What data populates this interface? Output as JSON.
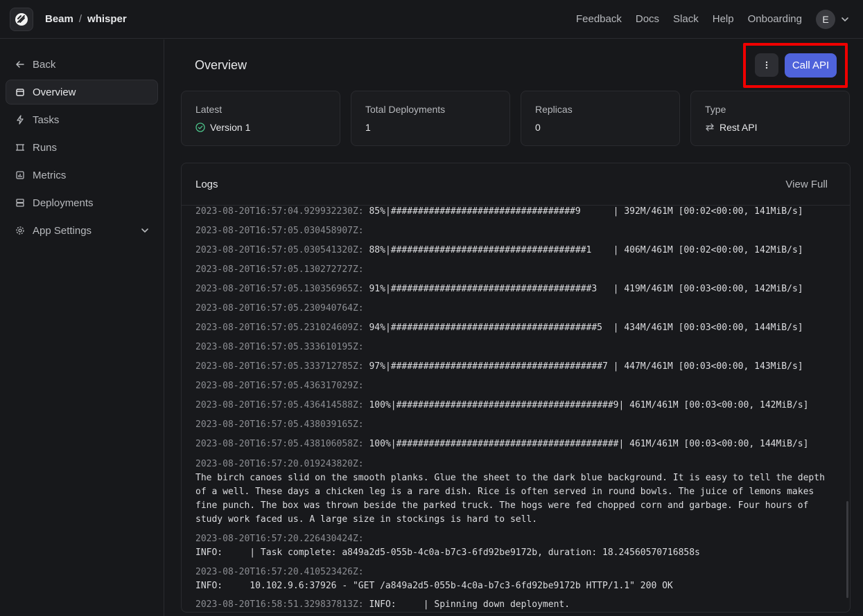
{
  "topbar": {
    "org": "Beam",
    "separator": "/",
    "app": "whisper",
    "nav": [
      "Feedback",
      "Docs",
      "Slack",
      "Help",
      "Onboarding"
    ],
    "avatar_initial": "E"
  },
  "sidebar": {
    "items": [
      {
        "label": "Back",
        "icon": "arrow-left-icon"
      },
      {
        "label": "Overview",
        "icon": "calendar-icon"
      },
      {
        "label": "Tasks",
        "icon": "bolt-icon"
      },
      {
        "label": "Runs",
        "icon": "runs-icon"
      },
      {
        "label": "Metrics",
        "icon": "chart-icon"
      },
      {
        "label": "Deployments",
        "icon": "server-icon"
      },
      {
        "label": "App Settings",
        "icon": "gear-icon"
      }
    ]
  },
  "main": {
    "title": "Overview",
    "call_api_label": "Call API",
    "cards": [
      {
        "label": "Latest",
        "value": "Version 1"
      },
      {
        "label": "Total Deployments",
        "value": "1"
      },
      {
        "label": "Replicas",
        "value": "0"
      },
      {
        "label": "Type",
        "value": "Rest API"
      }
    ]
  },
  "logs": {
    "title": "Logs",
    "view_full_label": "View Full",
    "lines": [
      {
        "ts": "2023-08-20T16:57:04.929932230Z:",
        "msg": " 85%|##################################9      | 392M/461M [00:02<00:00, 141MiB/s]"
      },
      {
        "ts": "2023-08-20T16:57:05.030458907Z:",
        "msg": ""
      },
      {
        "ts": "2023-08-20T16:57:05.030541320Z:",
        "msg": " 88%|####################################1    | 406M/461M [00:02<00:00, 142MiB/s]"
      },
      {
        "ts": "2023-08-20T16:57:05.130272727Z:",
        "msg": ""
      },
      {
        "ts": "2023-08-20T16:57:05.130356965Z:",
        "msg": " 91%|#####################################3   | 419M/461M [00:03<00:00, 142MiB/s]"
      },
      {
        "ts": "2023-08-20T16:57:05.230940764Z:",
        "msg": ""
      },
      {
        "ts": "2023-08-20T16:57:05.231024609Z:",
        "msg": " 94%|######################################5  | 434M/461M [00:03<00:00, 144MiB/s]"
      },
      {
        "ts": "2023-08-20T16:57:05.333610195Z:",
        "msg": ""
      },
      {
        "ts": "2023-08-20T16:57:05.333712785Z:",
        "msg": " 97%|#######################################7 | 447M/461M [00:03<00:00, 143MiB/s]"
      },
      {
        "ts": "2023-08-20T16:57:05.436317029Z:",
        "msg": ""
      },
      {
        "ts": "2023-08-20T16:57:05.436414588Z:",
        "msg": " 100%|########################################9| 461M/461M [00:03<00:00, 142MiB/s]"
      },
      {
        "ts": "2023-08-20T16:57:05.438039165Z:",
        "msg": ""
      },
      {
        "ts": "2023-08-20T16:57:05.438106058Z:",
        "msg": " 100%|#########################################| 461M/461M [00:03<00:00, 144MiB/s]"
      }
    ],
    "blocks": [
      {
        "ts": "2023-08-20T16:57:20.019243820Z:",
        "msg": "The birch canoes slid on the smooth planks. Glue the sheet to the dark blue background. It is easy to tell the depth of a well. These days a chicken leg is a rare dish. Rice is often served in round bowls. The juice of lemons makes fine punch. The box was thrown beside the parked truck. The hogs were fed chopped corn and garbage. Four hours of study work faced us. A large size in stockings is hard to sell."
      },
      {
        "ts": "2023-08-20T16:57:20.226430424Z:",
        "msg": "INFO:     | Task complete: a849a2d5-055b-4c0a-b7c3-6fd92be9172b, duration: 18.24560570716858s"
      },
      {
        "ts": "2023-08-20T16:57:20.410523426Z:",
        "msg": "INFO:     10.102.9.6:37926 - \"GET /a849a2d5-055b-4c0a-b7c3-6fd92be9172b HTTP/1.1\" 200 OK"
      }
    ],
    "last_line": {
      "ts": "2023-08-20T16:58:51.329837813Z:",
      "msg": " INFO:     | Spinning down deployment."
    }
  },
  "colors": {
    "accent": "#4f63db",
    "success": "#4cc38a",
    "highlight": "#f00000"
  }
}
